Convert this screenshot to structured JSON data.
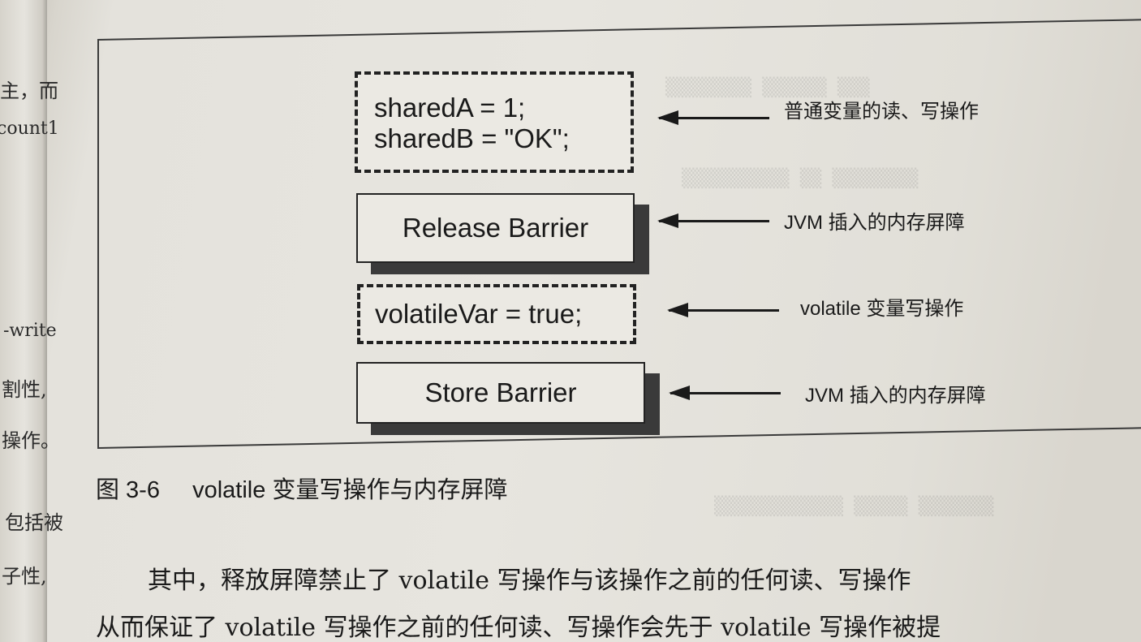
{
  "left_margin_fragments": [
    "主，而",
    "count1",
    "-write",
    "割性,",
    "操作。",
    "包括被",
    "子性,"
  ],
  "figure": {
    "code_block_1": [
      "sharedA = 1;",
      "sharedB = \"OK\";"
    ],
    "release_barrier": "Release Barrier",
    "code_block_2": "volatileVar = true;",
    "store_barrier": "Store Barrier",
    "annotations": {
      "normal_rw": "普通变量的读、写操作",
      "jvm_barrier_1": "JVM 插入的内存屏障",
      "volatile_write": "volatile 变量写操作",
      "jvm_barrier_2": "JVM 插入的内存屏障"
    }
  },
  "caption": {
    "number": "图 3-6",
    "title": "volatile 变量写操作与内存屏障"
  },
  "body": {
    "line1": "其中，释放屏障禁止了 volatile 写操作与该操作之前的任何读、写操作",
    "line2": "从而保证了 volatile 写操作之前的任何读、写操作会先于 volatile 写操作被提"
  }
}
